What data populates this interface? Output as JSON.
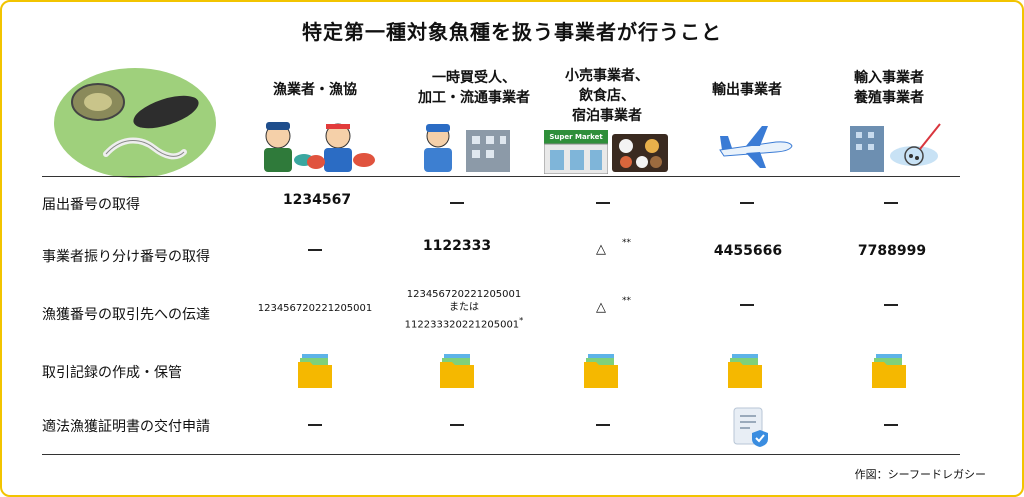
{
  "title": "特定第一種対象魚種を扱う事業者が行うこと",
  "columns": [
    {
      "lines": [
        "漁業者・漁協"
      ]
    },
    {
      "lines": [
        "一時買受人、",
        "加工・流通事業者"
      ]
    },
    {
      "lines": [
        "小売事業者、",
        "飲食店、",
        "宿泊事業者"
      ]
    },
    {
      "lines": [
        "輸出事業者"
      ]
    },
    {
      "lines": [
        "輸入事業者",
        "養殖事業者"
      ]
    }
  ],
  "supermarket_sign": "Super Market",
  "rows": [
    {
      "label": "届出番号の取得",
      "cells": [
        "1234567",
        "—",
        "—",
        "—",
        "—"
      ]
    },
    {
      "label": "事業者振り分け番号の取得",
      "cells": [
        "—",
        "1122333",
        "△",
        "4455666",
        "7788999"
      ]
    },
    {
      "label": "漁獲番号の取引先への伝達",
      "cells": [
        "123456720221205001",
        "123456720221205001",
        "△",
        "—",
        "—"
      ]
    },
    {
      "label": "取引記録の作成・保管",
      "cells": [
        "folder-icon",
        "folder-icon",
        "folder-icon",
        "folder-icon",
        "folder-icon"
      ]
    },
    {
      "label": "適法漁獲証明書の交付申請",
      "cells": [
        "—",
        "—",
        "—",
        "document-shield-icon",
        "—"
      ]
    }
  ],
  "or_text": "または",
  "alt_number": "112233320221205001",
  "star_single": "*",
  "star_double": "**",
  "footer": "作図：シーフードレガシー",
  "colors": {
    "frame": "#f2c400",
    "hero_bg": "#9fd07c",
    "folder": "#f5b800"
  }
}
